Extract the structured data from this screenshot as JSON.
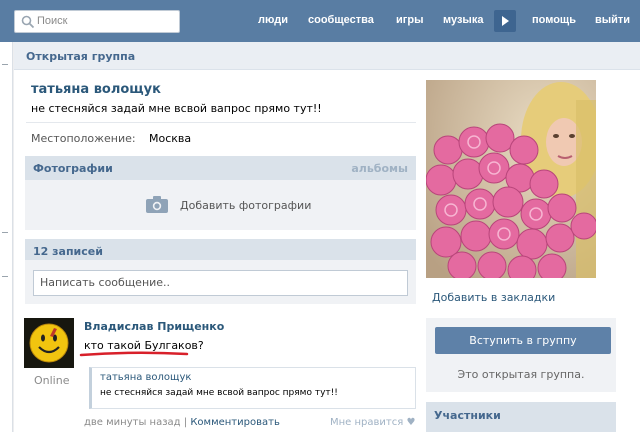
{
  "topbar": {
    "search_placeholder": "Поиск",
    "nav": [
      "люди",
      "сообщества",
      "игры",
      "музыка",
      "помощь",
      "выйти"
    ]
  },
  "group": {
    "header": "Открытая группа",
    "name": "татьяна волощук",
    "status": "не стесняйся задай мне всвой вапрос прямо тут!!",
    "location_label": "Местоположение:",
    "location_value": "Москва"
  },
  "photos": {
    "title": "Фотографии",
    "albums_link": "альбомы",
    "add_label": "Добавить фотографии"
  },
  "wall": {
    "count_title": "12 записей",
    "message_placeholder": "Написать сообщение..",
    "post": {
      "author": "Владислав Прищенко",
      "text": "кто такой Булгаков?",
      "online": "Online",
      "quote_name": "татьяна волощук",
      "quote_text": "не стесняйся задай мне всвой вапрос прямо тут!!",
      "time": "две минуты назад",
      "divider": "|",
      "comment": "Комментировать",
      "like": "Мне нравится"
    }
  },
  "sidebar": {
    "bookmark": "Добавить в закладки",
    "join_button": "Вступить в группу",
    "open_group_note": "Это открытая группа.",
    "members_title": "Участники"
  },
  "colors": {
    "topbar": "#597da3",
    "link": "#2b587a",
    "section_bar": "#dae2ea",
    "button": "#5e81a8",
    "annotation_red": "#d8202a"
  }
}
